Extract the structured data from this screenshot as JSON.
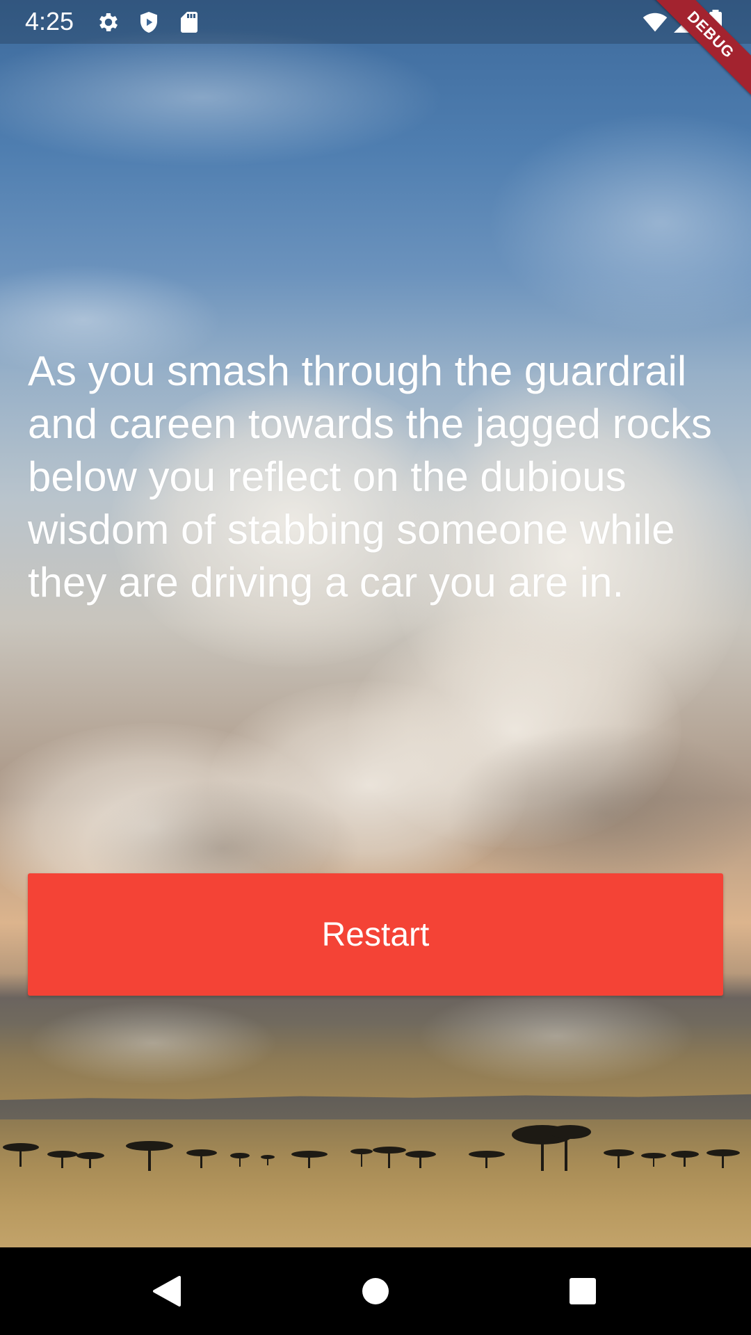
{
  "status_bar": {
    "time": "4:25",
    "icons": [
      "gear-icon",
      "play-protect-icon",
      "sd-card-icon",
      "wifi-icon",
      "signal-icon",
      "battery-icon"
    ],
    "debug_label": "DEBUG"
  },
  "story": {
    "text": "As you smash through the guardrail and careen towards the jagged rocks below you reflect on the dubious wisdom of stabbing someone while they are driving a car you are in."
  },
  "restart_button": {
    "label": "Restart",
    "color": "#f44336"
  },
  "nav_bar": {
    "icons": [
      "back-icon",
      "home-icon",
      "recents-icon"
    ]
  }
}
